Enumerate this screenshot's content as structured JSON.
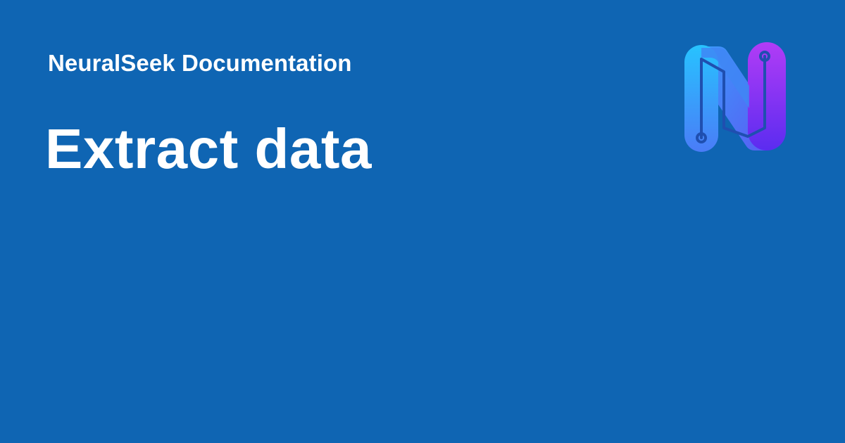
{
  "header": {
    "site_name": "NeuralSeek Documentation"
  },
  "main": {
    "title": "Extract data"
  },
  "logo": {
    "icon": "neuralseek-logo-icon",
    "colors": {
      "background": "#0f65b3",
      "gradient_cyan": "#27c3ff",
      "gradient_blue": "#4a6cf7",
      "gradient_purple": "#b13cf6",
      "gradient_indigo": "#5b2cf0",
      "circuit_line": "#1f4fb0"
    }
  }
}
